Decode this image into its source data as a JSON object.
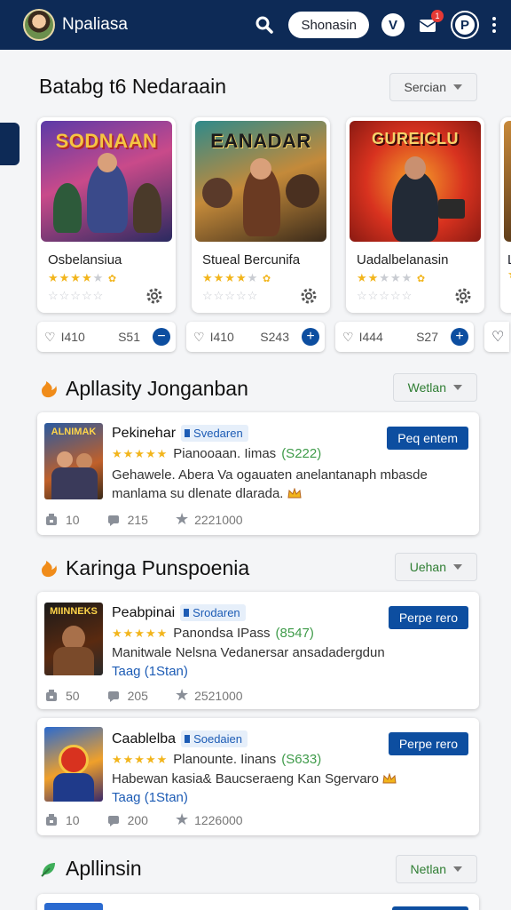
{
  "header": {
    "app_title": "Npaliasa",
    "pill_label": "Shonasin",
    "v_label": "V",
    "notif_count": "1",
    "p_label": "P",
    "icons": [
      "search-icon",
      "bell-icon",
      "kebab-menu-icon"
    ]
  },
  "featured": {
    "title": "Batabg t6 Nedaraain",
    "select_label": "Sercian",
    "games": [
      {
        "art_title": "SODNAAN",
        "name": "Osbelansiua",
        "rating": 4,
        "price_count": "I410",
        "price": "S51"
      },
      {
        "art_title": "EANADAR",
        "name": "Stueal Bercunifa",
        "rating": 3.5,
        "price_count": "I410",
        "price": "S243"
      },
      {
        "art_title": "GUREICLU",
        "name": "Uadalbelanasin",
        "rating": 2,
        "price_count": "I444",
        "price": "S27"
      }
    ],
    "partial_label": "Le"
  },
  "section2": {
    "title": "Apllasity Jonganban",
    "select_label": "Wetlan",
    "apps": [
      {
        "thumb_title": "ALNIMAK",
        "name": "Pekinehar",
        "tag": "Svedaren",
        "plan": "Pianooaan. Iimas",
        "price": "(S222)",
        "desc": "Gehawele. Abera Va ogauaten anelantanaph mbasde manlama su dlenate dlarada.",
        "desc2": "",
        "button": "Peq entem",
        "downloads": "10",
        "reviews": "215",
        "score": "2221000"
      }
    ]
  },
  "section3": {
    "title": "Karinga Punspoenia",
    "select_label": "Uehan",
    "apps": [
      {
        "thumb_title": "MIINNEKS",
        "name": "Peabpinai",
        "tag": "Srodaren",
        "plan": "Panondsa IPass",
        "price": "(8547)",
        "desc": "Manitwale Nelsna Vedanersar ansadadergdun",
        "desc2": "Taag (1Stan)",
        "button": "Perpe rero",
        "downloads": "50",
        "reviews": "205",
        "score": "2521000"
      },
      {
        "thumb_title": "",
        "name": "Caablelba",
        "tag": "Soedaien",
        "plan": "Planounte. Iinans",
        "price": "(S633)",
        "desc": "Habewan kasia& Baucseraeng Kan Sgervaro",
        "desc2": "Taag (1Stan)",
        "button": "Perpe rero",
        "downloads": "10",
        "reviews": "200",
        "score": "1226000"
      }
    ]
  },
  "section4": {
    "title": "Apllinsin",
    "select_label": "Netlan"
  }
}
